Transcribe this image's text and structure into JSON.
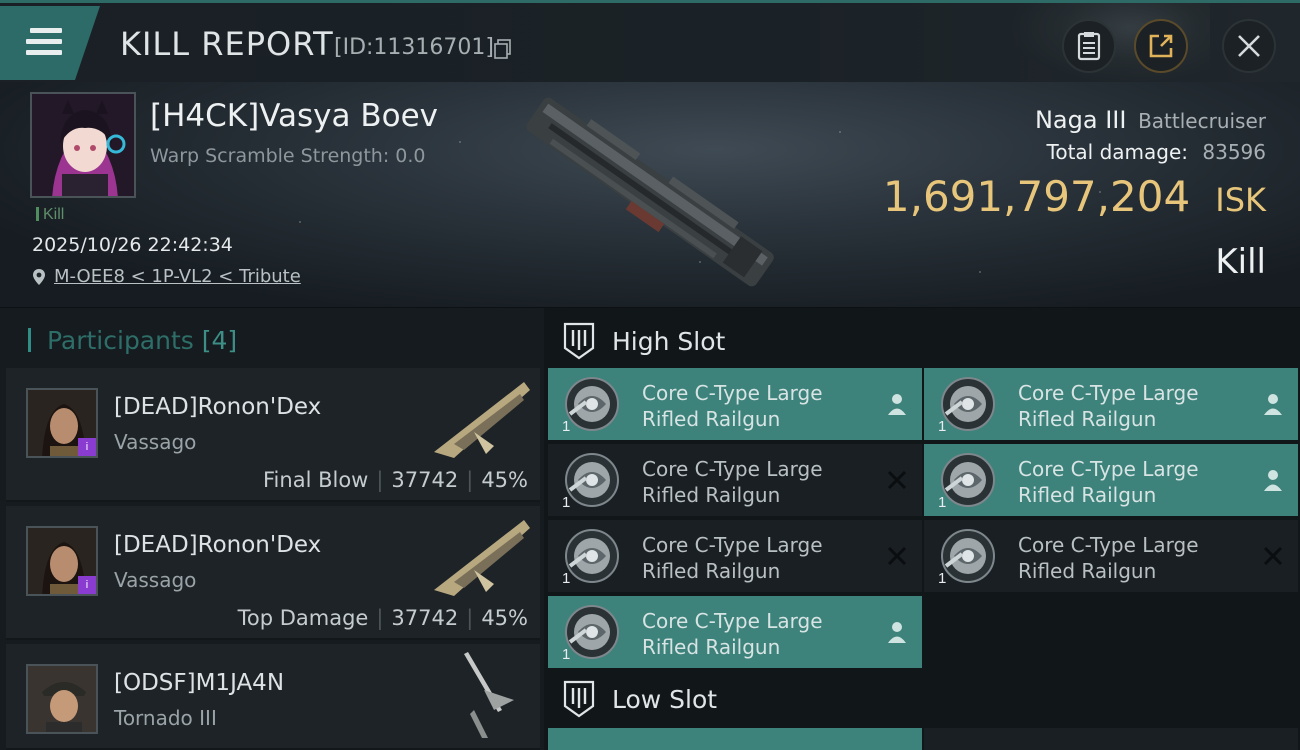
{
  "header": {
    "title": "KILL REPORT",
    "report_id": "[ID:11316701]",
    "icons": {
      "menu": "menu-icon",
      "copy": "copy-icon",
      "clipboard": "clipboard-icon",
      "share": "share-icon",
      "close": "close-icon"
    }
  },
  "victim": {
    "name": "[H4CK]Vasya Boev",
    "warp_scramble": "Warp Scramble Strength: 0.0",
    "tag": "Kill",
    "datetime": "2025/10/26 22:42:34",
    "location": "M-OEE8 < 1P-VL2 < Tribute",
    "ship_name": "Naga III",
    "ship_class": "Battlecruiser",
    "damage_label": "Total damage:",
    "damage_value": "83596",
    "isk_value": "1,691,797,204",
    "isk_unit": "ISK",
    "result": "Kill"
  },
  "participants": {
    "label": "Participants",
    "count": "[4]",
    "rows": [
      {
        "name": "[DEAD]Ronon'Dex",
        "ship": "Vassago",
        "role": "Final Blow",
        "damage": "37742",
        "percent": "45%",
        "badge": "i"
      },
      {
        "name": "[DEAD]Ronon'Dex",
        "ship": "Vassago",
        "role": "Top Damage",
        "damage": "37742",
        "percent": "45%",
        "badge": "i"
      },
      {
        "name": "[ODSF]M1JA4N",
        "ship": "Tornado III"
      }
    ]
  },
  "slots": {
    "high_label": "High Slot",
    "low_label": "Low Slot",
    "high_items": [
      {
        "line1": "Core C-Type Large",
        "line2": "Rifled Railgun",
        "qty": "1",
        "state": "dropped"
      },
      {
        "line1": "Core C-Type Large",
        "line2": "Rifled Railgun",
        "qty": "1",
        "state": "dropped"
      },
      {
        "line1": "Core C-Type Large",
        "line2": "Rifled Railgun",
        "qty": "1",
        "state": "destroyed"
      },
      {
        "line1": "Core C-Type Large",
        "line2": "Rifled Railgun",
        "qty": "1",
        "state": "dropped"
      },
      {
        "line1": "Core C-Type Large",
        "line2": "Rifled Railgun",
        "qty": "1",
        "state": "destroyed"
      },
      {
        "line1": "Core C-Type Large",
        "line2": "Rifled Railgun",
        "qty": "1",
        "state": "destroyed"
      },
      {
        "line1": "Core C-Type Large",
        "line2": "Rifled Railgun",
        "qty": "1",
        "state": "dropped"
      }
    ]
  },
  "colors": {
    "accent": "#3d827b",
    "isk": "#e7c57a",
    "badge": "#8a3bd0"
  }
}
